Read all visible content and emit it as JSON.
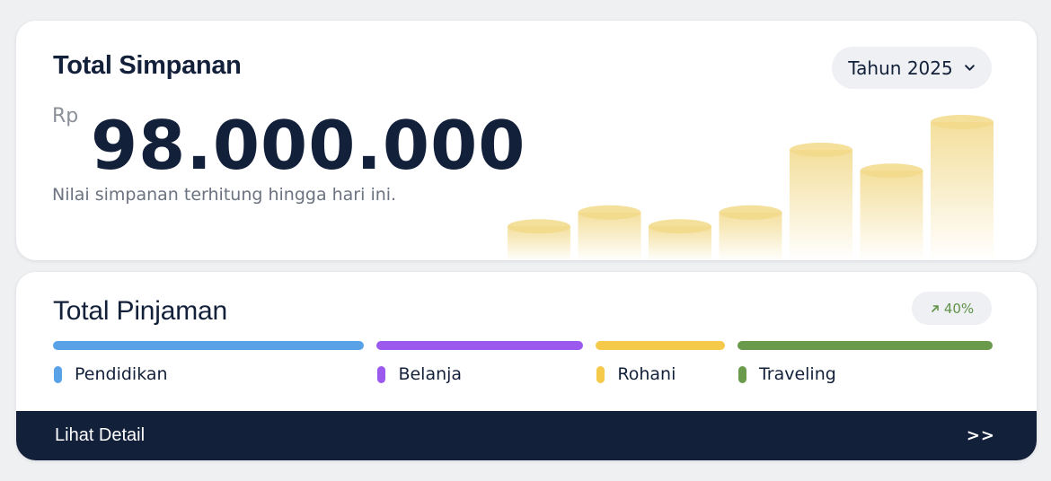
{
  "savings": {
    "title": "Total Simpanan",
    "year_select": "Tahun 2025",
    "currency": "Rp",
    "amount": "98.000.000",
    "subtitle": "Nilai simpanan terhitung hingga hari ini.",
    "coin_color": "#f2d98a",
    "coin_levels": [
      0.25,
      0.35,
      0.25,
      0.35,
      0.8,
      0.65,
      1.0
    ]
  },
  "loans": {
    "title": "Total Pinjaman",
    "trend": "40%",
    "trend_color": "#5f9248",
    "categories": [
      {
        "label": "Pendidikan",
        "color": "#5aa2e8",
        "share": 0.333
      },
      {
        "label": "Belanja",
        "color": "#9b59ee",
        "share": 0.221
      },
      {
        "label": "Rohani",
        "color": "#f5c94a",
        "share": 0.138
      },
      {
        "label": "Traveling",
        "color": "#6a9a4c",
        "share": 0.273
      }
    ],
    "detail_label": "Lihat Detail",
    "detail_icon": ">>"
  }
}
